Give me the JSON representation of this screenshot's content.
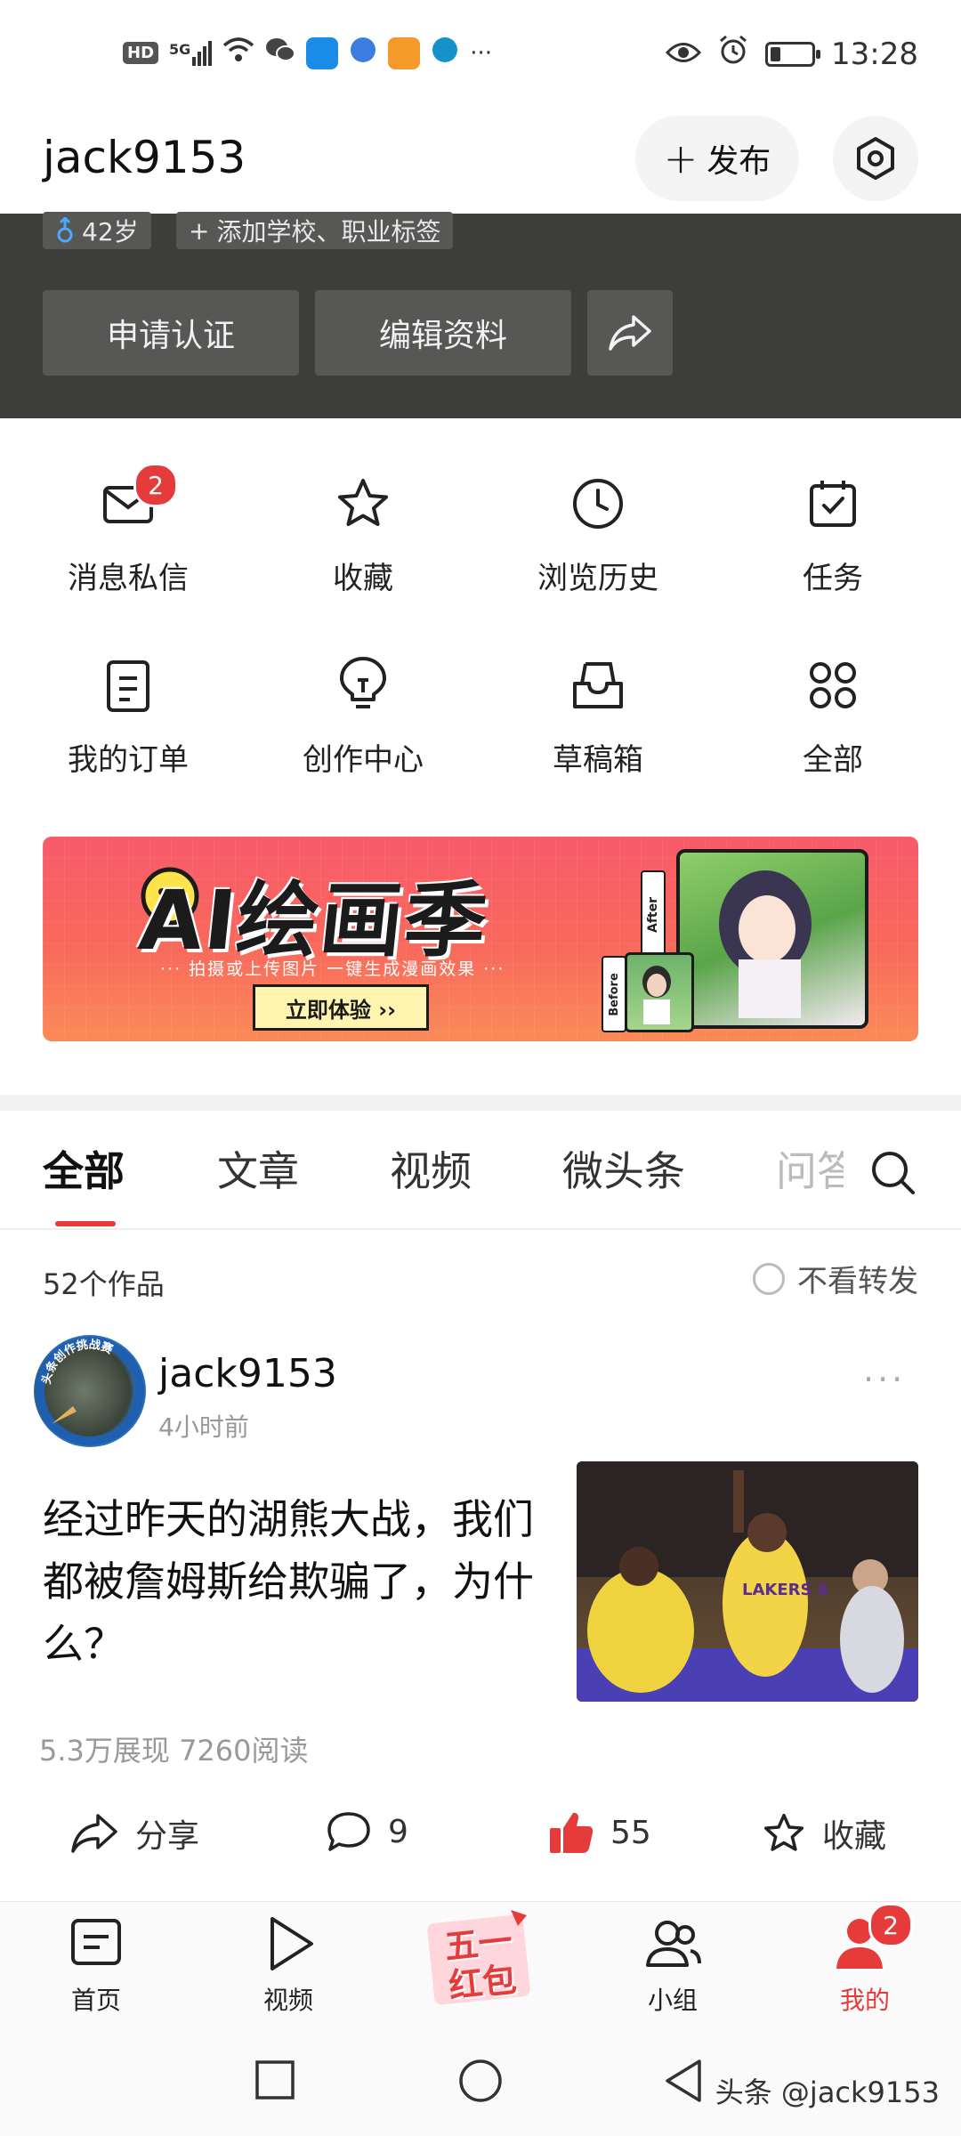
{
  "status_bar": {
    "hd": "HD",
    "signal": "5G",
    "more": "···",
    "time": "13:28",
    "battery_fraction": 0.25
  },
  "header": {
    "username": "jack9153",
    "publish_label": "发布"
  },
  "profile": {
    "age_tag": "42岁",
    "school_tag": "添加学校、职业标签",
    "apply_cert": "申请认证",
    "edit_profile": "编辑资料"
  },
  "grid": [
    {
      "label": "消息私信",
      "icon": "mail-icon",
      "badge": "2"
    },
    {
      "label": "收藏",
      "icon": "star-icon"
    },
    {
      "label": "浏览历史",
      "icon": "clock-icon"
    },
    {
      "label": "任务",
      "icon": "calendar-check-icon"
    },
    {
      "label": "我的订单",
      "icon": "order-icon"
    },
    {
      "label": "创作中心",
      "icon": "bulb-icon"
    },
    {
      "label": "草稿箱",
      "icon": "inbox-icon"
    },
    {
      "label": "全部",
      "icon": "grid-icon"
    }
  ],
  "banner": {
    "title": "AI绘画季",
    "subtitle": "··· 拍摄或上传图片 一键生成漫画效果 ···",
    "button": "立即体验 ››",
    "after_label": "After",
    "before_label": "Before"
  },
  "tabs": [
    "全部",
    "文章",
    "视频",
    "微头条",
    "问答"
  ],
  "works": {
    "count": "52个作品",
    "no_forward": "不看转发"
  },
  "post": {
    "author": "jack9153",
    "time": "4小时前",
    "avatar_text": "头条创作挑战赛",
    "title": "经过昨天的湖熊大战，我们都被詹姆斯给欺骗了，为什么？",
    "thumb_text": "LAKERS 6",
    "stats": "5.3万展现   7260阅读",
    "share": "分享",
    "comments": "9",
    "likes": "55",
    "collect": "收藏"
  },
  "bottom_nav": {
    "home": "首页",
    "video": "视频",
    "promo": "五一红包",
    "group": "小组",
    "mine": "我的",
    "mine_badge": "2"
  },
  "watermark": "头条 @jack9153"
}
